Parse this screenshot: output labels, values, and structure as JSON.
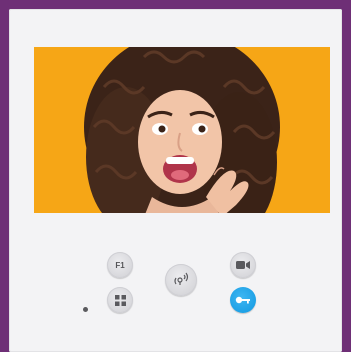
{
  "panel": {
    "brand": ""
  },
  "screen": {
    "image": "woman-surprised-photo",
    "background_color": "#f6a616"
  },
  "buttons": {
    "f1": {
      "label": "F1",
      "icon": "f1-label"
    },
    "menu": {
      "icon": "grid-icon"
    },
    "talk": {
      "icon": "talk-icon"
    },
    "camera": {
      "icon": "camera-icon"
    },
    "door": {
      "icon": "key-icon",
      "color": "#1ea1e6"
    }
  },
  "status": {
    "led_color": "#5a5a5e"
  }
}
